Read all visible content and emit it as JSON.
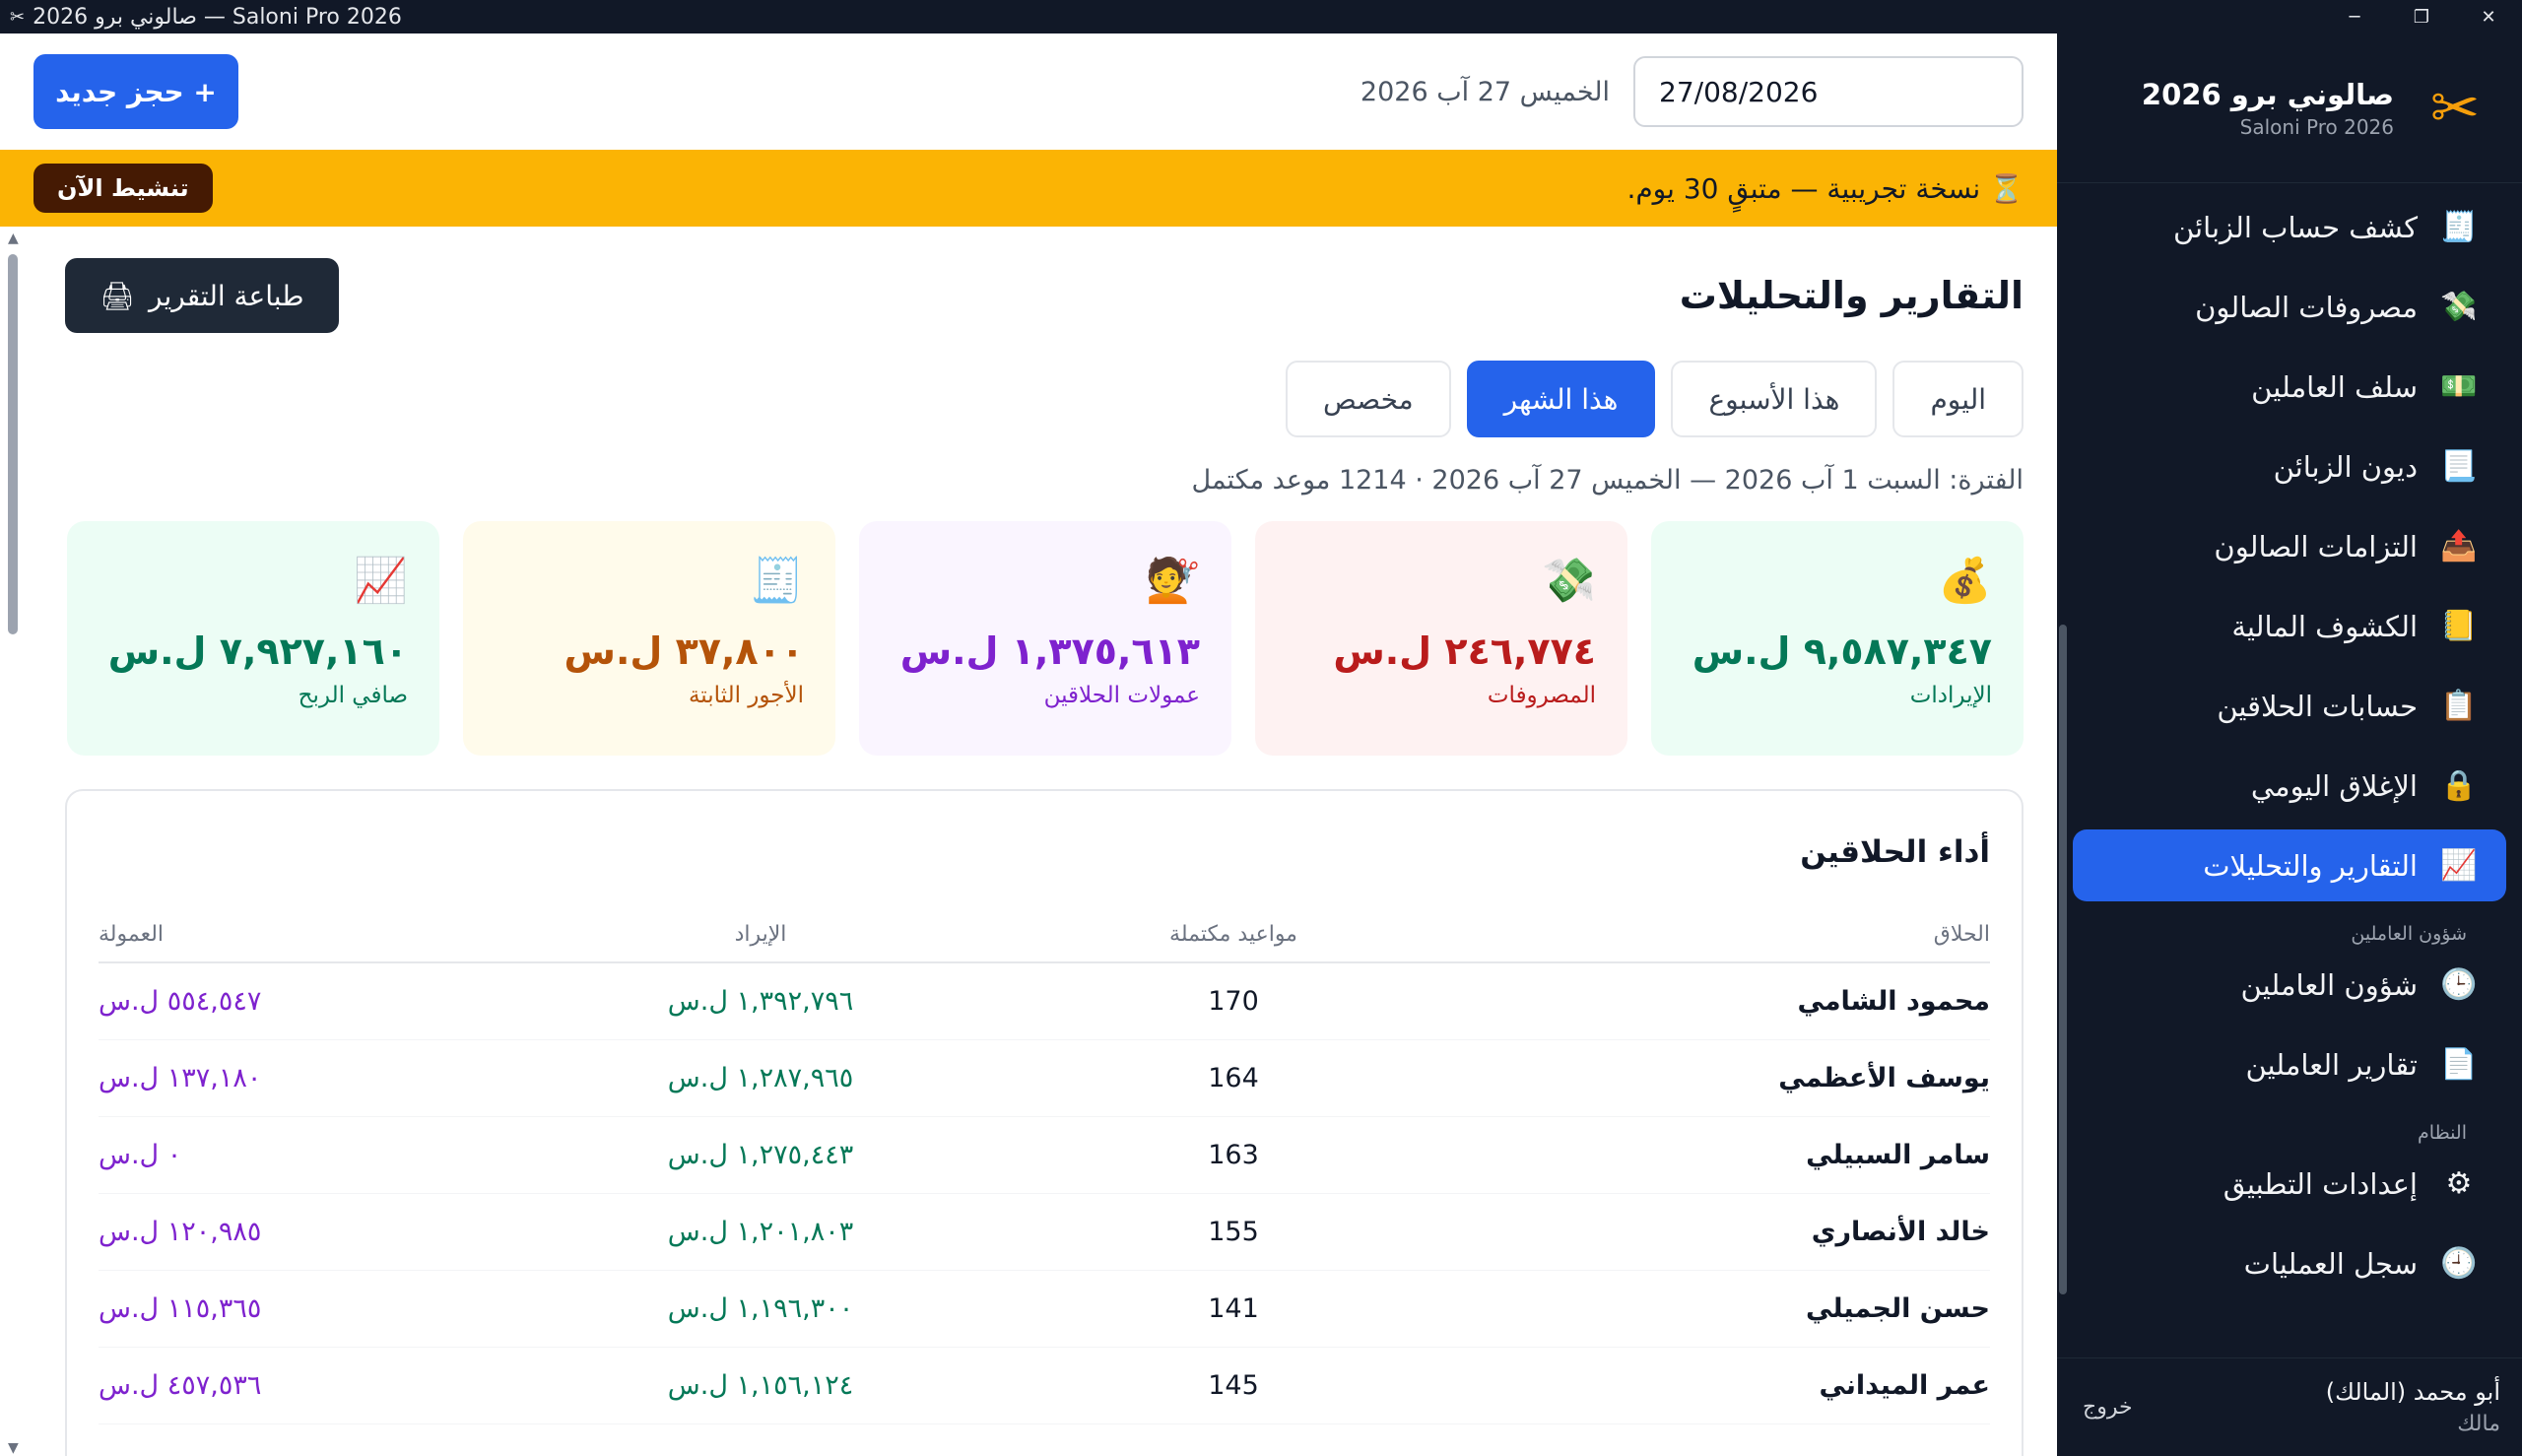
{
  "window": {
    "title": "صالوني برو 2026 — Saloni Pro 2026",
    "controls": [
      "─",
      "❐",
      "✕"
    ]
  },
  "brand": {
    "name": "صالوني برو 2026",
    "subtitle": "Saloni Pro 2026",
    "logo_icon": "scissors-icon"
  },
  "sidebar": {
    "items": [
      {
        "label": "كشف حساب الزبائن",
        "icon": "🧾",
        "icon_name": "statement-icon"
      },
      {
        "label": "مصروفات الصالون",
        "icon": "💸",
        "icon_name": "money-wings-icon"
      },
      {
        "label": "سلف العاملين",
        "icon": "💵",
        "icon_name": "banknote-icon"
      },
      {
        "label": "ديون الزبائن",
        "icon": "📃",
        "icon_name": "page-icon"
      },
      {
        "label": "التزامات الصالون",
        "icon": "📤",
        "icon_name": "outbox-icon"
      },
      {
        "label": "الكشوف المالية",
        "icon": "📒",
        "icon_name": "ledger-icon"
      },
      {
        "label": "حسابات الحلاقين",
        "icon": "📋",
        "icon_name": "clipboard-icon"
      },
      {
        "label": "الإغلاق اليومي",
        "icon": "🔒",
        "icon_name": "lock-icon"
      },
      {
        "label": "التقارير والتحليلات",
        "icon": "📈",
        "icon_name": "chart-up-icon",
        "active": true
      }
    ],
    "section_staff": "شؤون العاملين",
    "staff_items": [
      {
        "label": "شؤون العاملين",
        "icon": "🕒",
        "icon_name": "clock-icon"
      },
      {
        "label": "تقارير العاملين",
        "icon": "📄",
        "icon_name": "document-icon"
      }
    ],
    "section_system": "النظام",
    "system_items": [
      {
        "label": "إعدادات التطبيق",
        "icon": "⚙",
        "icon_name": "gear-icon"
      },
      {
        "label": "سجل العمليات",
        "icon": "🕘",
        "icon_name": "history-icon"
      }
    ],
    "user": {
      "name": "أبو محمد (المالك)",
      "role": "مالك",
      "logout": "خروج"
    }
  },
  "topbar": {
    "date_value": "27/08/2026",
    "date_label": "الخميس 27 آب 2026",
    "new_booking": "+ حجز جديد"
  },
  "trial": {
    "icon": "⏳",
    "text": "نسخة تجريبية — متبقٍ 30 يوم.",
    "activate": "تنشيط الآن"
  },
  "page": {
    "title": "التقارير والتحليلات",
    "print": "طباعة التقرير",
    "tabs": [
      "اليوم",
      "هذا الأسبوع",
      "هذا الشهر",
      "مخصص"
    ],
    "active_tab": "هذا الشهر",
    "period": "الفترة: السبت 1 آب 2026 — الخميس 27 آب 2026 · 1214 موعد مكتمل"
  },
  "cards": [
    {
      "icon": "💰",
      "value": "٩,٥٨٧,٣٤٧ ل.س",
      "label": "الإيرادات"
    },
    {
      "icon": "💸",
      "value": "٢٤٦,٧٧٤ ل.س",
      "label": "المصروفات"
    },
    {
      "icon": "💇",
      "value": "١,٣٧٥,٦١٣ ل.س",
      "label": "عمولات الحلاقين"
    },
    {
      "icon": "🧾",
      "value": "٣٧,٨٠٠ ل.س",
      "label": "الأجور الثابتة"
    },
    {
      "icon": "📈",
      "value": "٧,٩٢٧,١٦٠ ل.س",
      "label": "صافي الربح"
    }
  ],
  "performance": {
    "title": "أداء الحلاقين",
    "headers": {
      "name": "الحلاق",
      "count": "مواعيد مكتملة",
      "revenue": "الإيراد",
      "commission": "العمولة"
    },
    "rows": [
      {
        "name": "محمود الشامي",
        "count": "170",
        "revenue": "١,٣٩٢,٧٩٦ ل.س",
        "commission": "٥٥٤,٥٤٧ ل.س"
      },
      {
        "name": "يوسف الأعظمي",
        "count": "164",
        "revenue": "١,٢٨٧,٩٦٥ ل.س",
        "commission": "١٣٧,١٨٠ ل.س"
      },
      {
        "name": "سامر السبيلي",
        "count": "163",
        "revenue": "١,٢٧٥,٤٤٣ ل.س",
        "commission": "٠ ل.س"
      },
      {
        "name": "خالد الأنصاري",
        "count": "155",
        "revenue": "١,٢٠١,٨٠٣ ل.س",
        "commission": "١٢٠,٩٨٥ ل.س"
      },
      {
        "name": "حسن الجميلي",
        "count": "141",
        "revenue": "١,١٩٦,٣٠٠ ل.س",
        "commission": "١١٥,٣٦٥ ل.س"
      },
      {
        "name": "عمر الميداني",
        "count": "145",
        "revenue": "١,١٥٦,١٢٤ ل.س",
        "commission": "٤٥٧,٥٣٦ ل.س"
      }
    ]
  },
  "colors": {
    "accent": "#2563eb",
    "sidebar": "#111827",
    "trial_bar": "#fbb404"
  }
}
